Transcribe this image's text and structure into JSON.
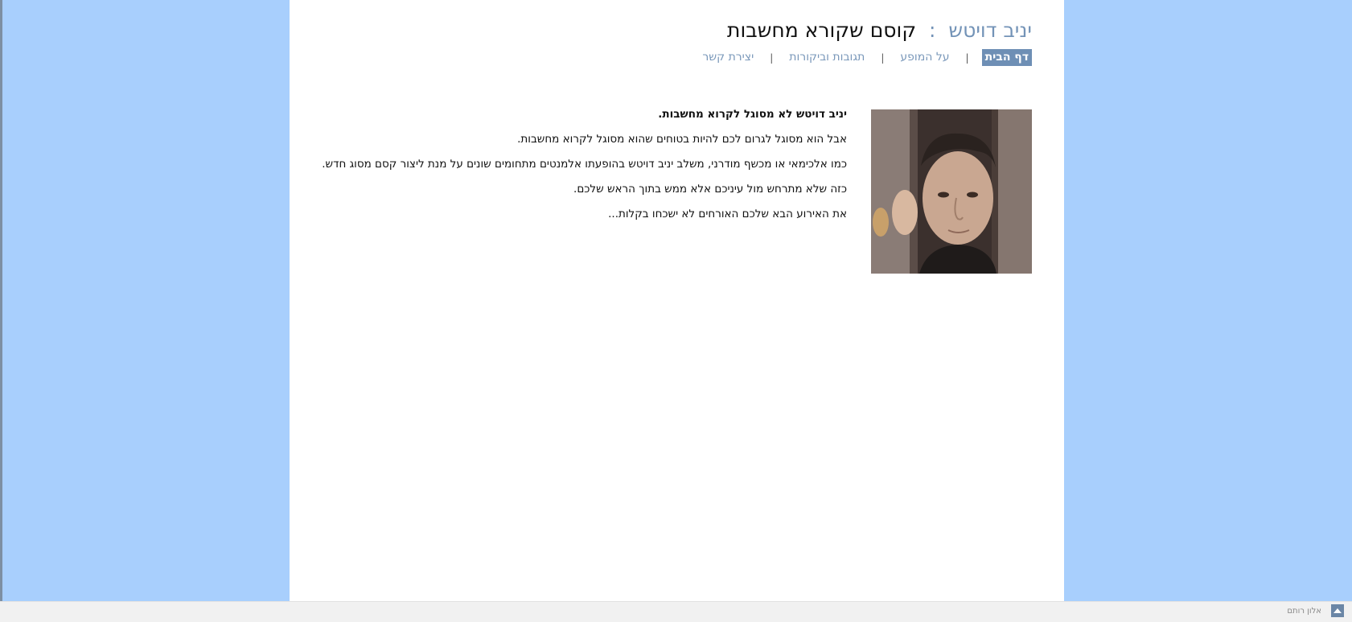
{
  "header": {
    "name": "יניב דויטש",
    "separator": ":",
    "subtitle": "קוסם שקורא מחשבות"
  },
  "nav": {
    "items": [
      {
        "label": "דף הבית",
        "active": true
      },
      {
        "label": "על המופע",
        "active": false
      },
      {
        "label": "תגובות וביקורות",
        "active": false
      },
      {
        "label": "יצירת קשר",
        "active": false
      }
    ],
    "separator": "|"
  },
  "content": {
    "lead": "יניב דויטש לא מסוגל לקרוא מחשבות.",
    "paragraphs": [
      "אבל הוא מסוגל לגרום לכם להיות בטוחים שהוא מסוגל לקרוא מחשבות.",
      "כמו אלכימאי או מכשף מודרני, משלב יניב דויטש בהופעתו אלמנטים מתחומים שונים על מנת ליצור קסם מסוג חדש.",
      "כזה שלא מתרחש מול עיניכם אלא ממש בתוך הראש שלכם.",
      "את האירוע הבא שלכם האורחים לא ישכחו בקלות..."
    ]
  },
  "footer": {
    "credit": "אלון רותם",
    "icon": "up-arrow-icon"
  },
  "colors": {
    "background": "#a8cffd",
    "accent": "#6e8fb5",
    "name": "#7393b7"
  }
}
